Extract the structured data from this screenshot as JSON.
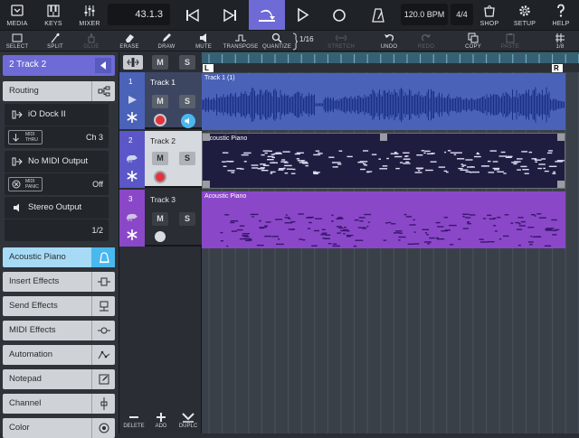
{
  "topbar": {
    "media": "MEDIA",
    "keys": "KEYS",
    "mixer": "MIXER",
    "position": "43.1.3",
    "tempo": "120.0 BPM",
    "signature": "4/4",
    "shop": "SHOP",
    "setup": "SETUP",
    "help": "HELP"
  },
  "toolbar": {
    "select": "SELECT",
    "split": "SPLIT",
    "glue": "GLUE",
    "erase": "ERASE",
    "draw": "DRAW",
    "mute": "MUTE",
    "transpose": "TRANSPOSE",
    "quantize": "QUANTIZE",
    "quantize_value": "1/16",
    "stretch": "STRETCH",
    "undo": "UNDO",
    "redo": "REDO",
    "copy": "COPY",
    "paste": "PASTE",
    "grid": "1/8"
  },
  "inspector": {
    "track_title": "2  Track 2",
    "routing_label": "Routing",
    "input_device": "iO Dock II",
    "midi_thru": "MIDI THRU",
    "midi_thru_l1": "MIDI",
    "midi_thru_l2": "THRU",
    "channel": "Ch 3",
    "output": "No MIDI Output",
    "midi_panic_l1": "MIDI",
    "midi_panic_l2": "PANIC",
    "output_state": "Off",
    "audio_output": "Stereo Output",
    "output_channel": "1/2",
    "instrument": "Acoustic Piano",
    "sections": [
      "Insert Effects",
      "Send Effects",
      "MIDI Effects",
      "Automation",
      "Notepad",
      "Channel",
      "Color"
    ]
  },
  "tracks": {
    "header_m": "M",
    "header_s": "S",
    "list": [
      {
        "number": "1",
        "name": "Track 1",
        "m": "M",
        "s": "S"
      },
      {
        "number": "2",
        "name": "Track 2",
        "m": "M",
        "s": "S"
      },
      {
        "number": "3",
        "name": "Track 3",
        "m": "M",
        "s": "S"
      }
    ],
    "footer": {
      "delete": "DELETE",
      "add": "ADD",
      "duplicate": "DUPLC"
    }
  },
  "arrange": {
    "locator_left": "L",
    "locator_right": "R",
    "parts": [
      {
        "name": "Track 1 (1)",
        "color": "#4a63b8"
      },
      {
        "name": "Acoustic Piano",
        "color": "#1f1d3f"
      },
      {
        "name": "Acoustic Piano",
        "color": "#8a48c8"
      }
    ]
  },
  "colors": {
    "accent": "#6e6ad6",
    "active_blue": "#4ab8ee",
    "record_red": "#e3343b",
    "track1": "#4a63b8",
    "track2": "#1f1d3f",
    "track3": "#8a48c8"
  }
}
